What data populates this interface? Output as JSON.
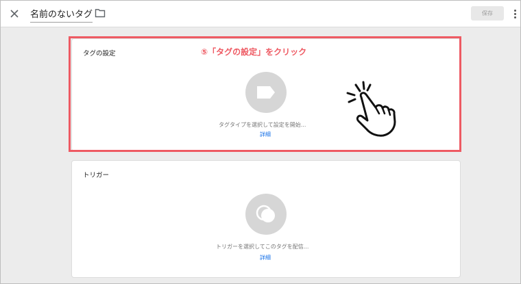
{
  "header": {
    "close_icon": "close-icon",
    "tag_name": "名前のないタグ",
    "folder_icon": "folder-icon",
    "save_label": "保存",
    "more_icon": "more-vert-icon"
  },
  "tag_config": {
    "title": "タグの設定",
    "icon": "tag-shape-icon",
    "hint": "タグタイプを選択して設定を開始...",
    "details_link": "詳細"
  },
  "triggering": {
    "title": "トリガー",
    "icon": "trigger-circles-icon",
    "hint": "トリガーを選択してこのタグを配信...",
    "details_link": "詳細"
  },
  "annotation": {
    "text": "⑤「タグの設定」をクリック",
    "highlight_color": "#ee5a63",
    "hand_icon": "tapping-hand-icon"
  },
  "colors": {
    "accent": "#1a73e8",
    "annotation": "#ee5a63"
  }
}
